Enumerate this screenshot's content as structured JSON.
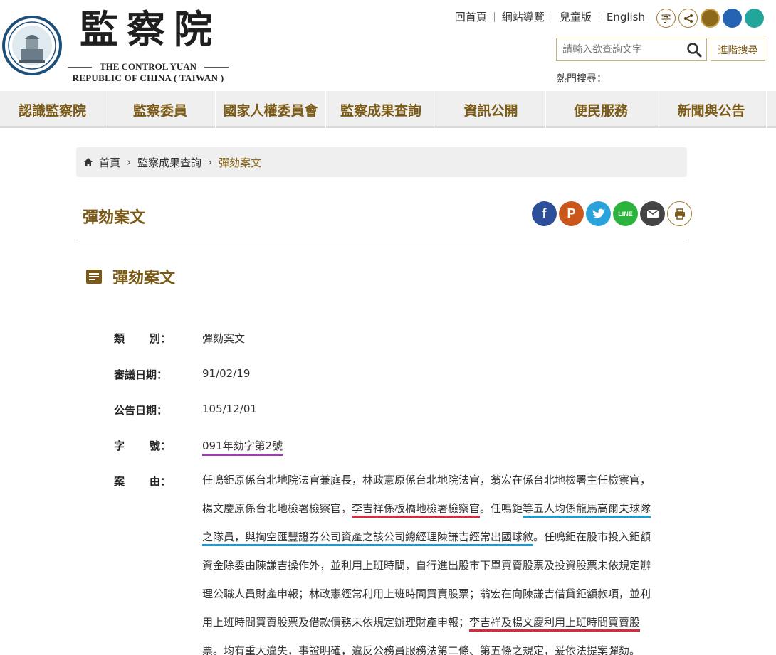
{
  "header": {
    "brand_cn": "監察院",
    "brand_en_1": "THE CONTROL YUAN",
    "brand_en_2": "REPUBLIC OF CHINA ( TAIWAN )",
    "seal_text": "中華民國監察院",
    "top_links": [
      "回首頁",
      "網站導覽",
      "兒童版",
      "English"
    ],
    "font_icon_label": "字",
    "search_placeholder": "請輸入欲查詢文字",
    "advanced_search": "進階搜尋",
    "hot_search": "熱門搜尋："
  },
  "nav": {
    "items": [
      "認識監察院",
      "監察委員",
      "國家人權委員會",
      "監察成果查詢",
      "資訊公開",
      "便民服務",
      "新聞與公告"
    ]
  },
  "breadcrumb": {
    "home": "首頁",
    "level1": "監察成果查詢",
    "current": "彈劾案文"
  },
  "page": {
    "title": "彈劾案文",
    "section_title": "彈劾案文",
    "share_icons": [
      "facebook-icon",
      "plurk-icon",
      "twitter-icon",
      "line-icon",
      "mail-icon",
      "print-icon"
    ]
  },
  "fields": {
    "category_label_1": "類",
    "category_label_2": "別：",
    "category": "彈劾案文",
    "review_date_label": "審議日期：",
    "review_date": "91/02/19",
    "announce_date_label": "公告日期：",
    "announce_date": "105/12/01",
    "number_label_1": "字",
    "number_label_2": "號：",
    "number": "091年劾字第2號",
    "reason_label_1": "案",
    "reason_label_2": "由："
  },
  "reason": {
    "l1": "任鳴鉅原係台北地院法官兼庭長，林政憲原係台北地院法官，翁宏在係台北地檢署主任檢察官，",
    "l2a": "楊文慶原係台北地檢署檢察官，",
    "l2b": "李吉祥係板橋地檢署檢察官",
    "l2c": "。任鳴鉅",
    "l2d": "等五人均係龍馬高爾夫球隊",
    "l3a": "之隊員，與掏空匯豐證券公司資產之該公司總經理陳謙吉經常出國球敘",
    "l3b": "。任鳴鉅在股市投入鉅額",
    "l4": "資金除委由陳謙吉操作外，並利用上班時間，自行進出股市下單買賣股票及投資股票未依規定辦",
    "l5": "理公職人員財產申報；林政憲經常利用上班時間買賣股票；翁宏在向陳謙吉借貸鉅額款項，並利",
    "l6a": "用上班時間買賣股票及借款債務未依規定辦理財產申報；",
    "l6b": "李吉祥及楊文慶利用上班時間買賣股",
    "l7a": "票。均有重大違失，事證明確，違反公務員服務法第二條、第五條之規定，爰依法提案彈劾",
    "l7b": "。"
  },
  "colors": {
    "accent": "#7a5a16",
    "underline_red": "#d62b3a",
    "underline_blue": "#1d9ad6",
    "underline_purple": "#9b3fb0"
  }
}
